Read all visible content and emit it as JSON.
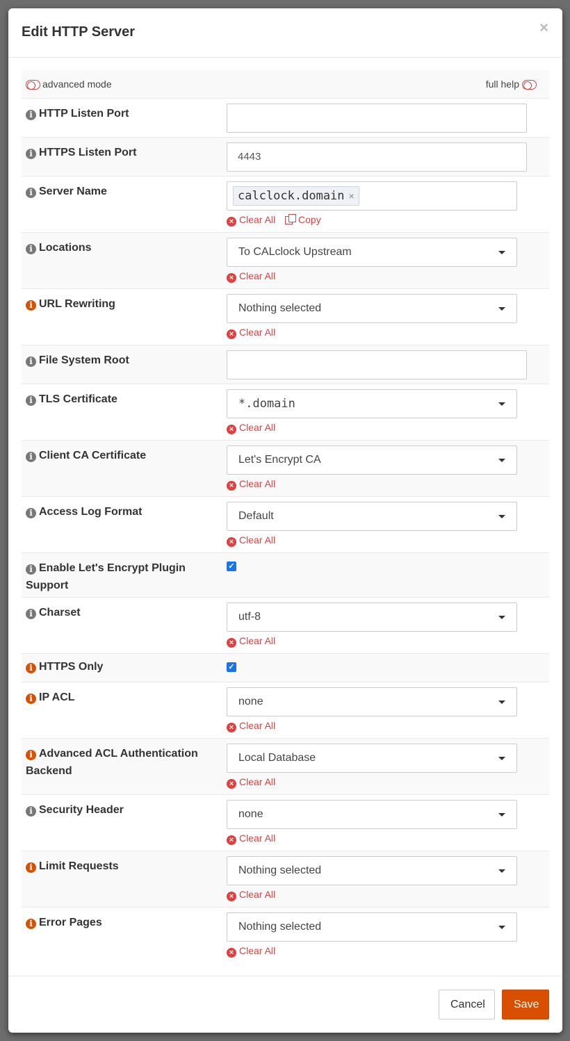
{
  "modal": {
    "title": "Edit HTTP Server",
    "close_symbol": "×"
  },
  "mode": {
    "advanced_label": "advanced mode",
    "full_help_label": "full help"
  },
  "fields": {
    "http_listen_port": {
      "label": "HTTP Listen Port",
      "value": ""
    },
    "https_listen_port": {
      "label": "HTTPS Listen Port",
      "value": "4443"
    },
    "server_name": {
      "label": "Server Name",
      "tag": "calclock.domain",
      "clear": "Clear All",
      "copy": "Copy"
    },
    "locations": {
      "label": "Locations",
      "value": "To CALclock Upstream",
      "clear": "Clear All"
    },
    "url_rewriting": {
      "label": "URL Rewriting",
      "value": "Nothing selected",
      "clear": "Clear All"
    },
    "file_system_root": {
      "label": "File System Root",
      "value": ""
    },
    "tls_certificate": {
      "label": "TLS Certificate",
      "value": "*.domain",
      "clear": "Clear All"
    },
    "client_ca_certificate": {
      "label": "Client CA Certificate",
      "value": "Let's Encrypt CA",
      "clear": "Clear All"
    },
    "access_log_format": {
      "label": "Access Log Format",
      "value": "Default",
      "clear": "Clear All"
    },
    "lets_encrypt": {
      "label": "Enable Let's Encrypt Plugin Support",
      "checked": true
    },
    "charset": {
      "label": "Charset",
      "value": "utf-8",
      "clear": "Clear All"
    },
    "https_only": {
      "label": "HTTPS Only",
      "checked": true
    },
    "ip_acl": {
      "label": "IP ACL",
      "value": "none",
      "clear": "Clear All"
    },
    "advanced_acl": {
      "label": "Advanced ACL Authentication Backend",
      "value": "Local Database",
      "clear": "Clear All"
    },
    "security_header": {
      "label": "Security Header",
      "value": "none",
      "clear": "Clear All"
    },
    "limit_requests": {
      "label": "Limit Requests",
      "value": "Nothing selected",
      "clear": "Clear All"
    },
    "error_pages": {
      "label": "Error Pages",
      "value": "Nothing selected",
      "clear": "Clear All"
    }
  },
  "footer": {
    "cancel_label": "Cancel",
    "save_label": "Save"
  },
  "colors": {
    "accent": "#d94f00",
    "danger": "#e04040",
    "checkbox": "#1a73e8"
  },
  "icons": {
    "info": "info-circle-icon",
    "clear": "times-circle-icon",
    "copy": "copy-icon",
    "toggle": "toggle-off-icon",
    "caret": "caret-down-icon"
  }
}
